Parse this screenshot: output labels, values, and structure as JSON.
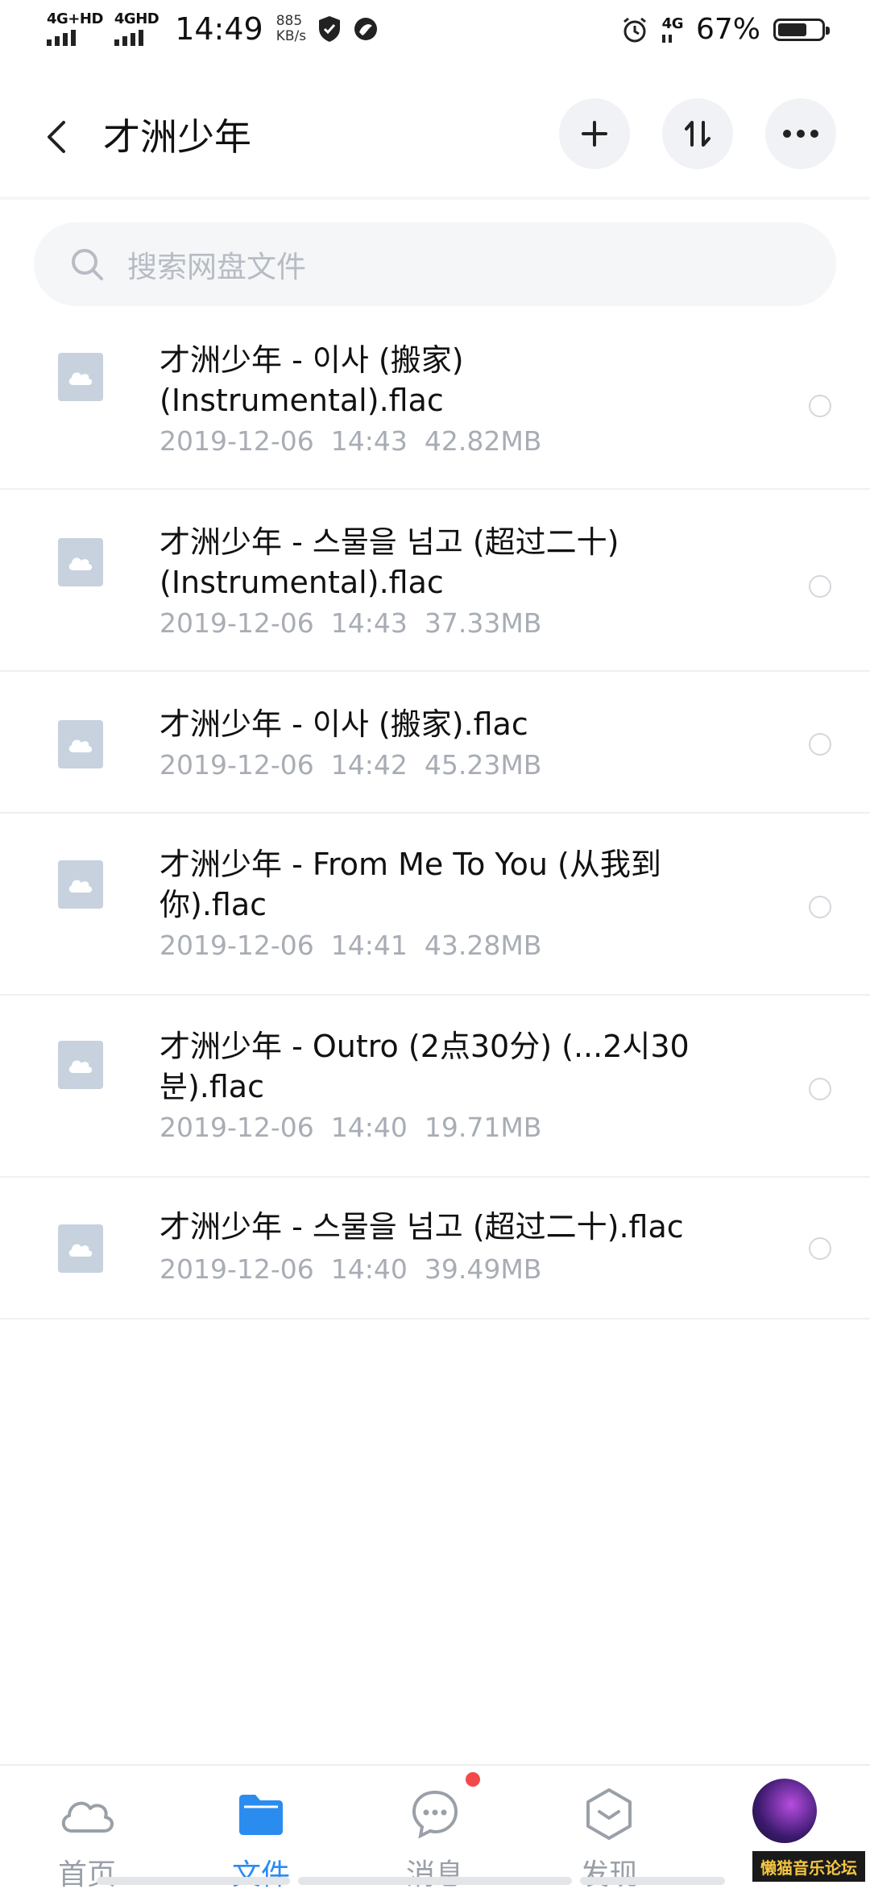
{
  "status_bar": {
    "net1": "4G+HD",
    "net2": "4GHD",
    "time": "14:49",
    "speed_value": "885",
    "speed_unit": "KB/s",
    "net3": "4G",
    "battery_text": "67%",
    "battery_level": 0.67
  },
  "header": {
    "title": "才洲少年"
  },
  "search": {
    "placeholder": "搜索网盘文件"
  },
  "files": [
    {
      "name": "才洲少年 - 이사 (搬家) (Instrumental).flac",
      "date": "2019-12-06",
      "time": "14:43",
      "size": "42.82MB"
    },
    {
      "name": "才洲少年 - 스물을 넘고 (超过二十) (Instrumental).flac",
      "date": "2019-12-06",
      "time": "14:43",
      "size": "37.33MB"
    },
    {
      "name": "才洲少年 - 이사 (搬家).flac",
      "date": "2019-12-06",
      "time": "14:42",
      "size": "45.23MB"
    },
    {
      "name": "才洲少年 - From Me To You (从我到你).flac",
      "date": "2019-12-06",
      "time": "14:41",
      "size": "43.28MB"
    },
    {
      "name": "才洲少年 - Outro (2点30分) (...2시30분).flac",
      "date": "2019-12-06",
      "time": "14:40",
      "size": "19.71MB"
    },
    {
      "name": "才洲少年 - 스물을 넘고 (超过二十).flac",
      "date": "2019-12-06",
      "time": "14:40",
      "size": "39.49MB"
    }
  ],
  "tabs": [
    {
      "label": "首页",
      "icon": "cloud-icon"
    },
    {
      "label": "文件",
      "icon": "folder-icon"
    },
    {
      "label": "消息",
      "icon": "chat-icon"
    },
    {
      "label": "发现",
      "icon": "discover-icon"
    }
  ],
  "watermark": "懒猫音乐论坛",
  "colors": {
    "accent": "#2b8cf0",
    "badge": "#f24a4a",
    "file_icon": "#c7d2de"
  }
}
